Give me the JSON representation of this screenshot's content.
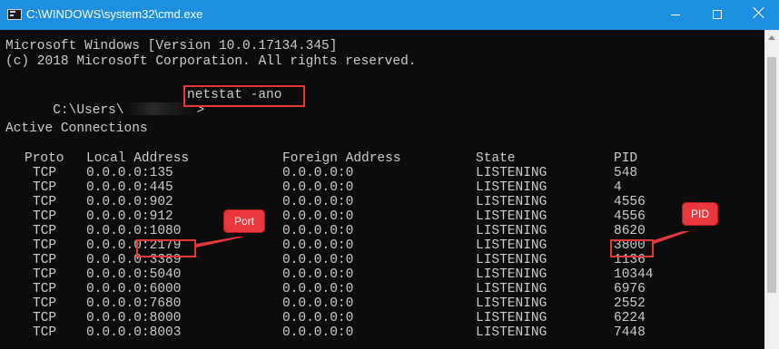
{
  "window": {
    "title": "C:\\WINDOWS\\system32\\cmd.exe",
    "buttons": {
      "minimize": "minimize",
      "maximize": "maximize",
      "close": "close"
    }
  },
  "console": {
    "header_line1": "Microsoft Windows [Version 10.0.17134.345]",
    "header_line2": "(c) 2018 Microsoft Corporation. All rights reserved.",
    "prompt_prefix": "C:\\Users\\",
    "command": "netstat -ano",
    "section_title": "Active Connections",
    "columns": {
      "proto": "Proto",
      "local": "Local Address",
      "foreign": "Foreign Address",
      "state": "State",
      "pid": "PID"
    },
    "rows": [
      {
        "proto": "TCP",
        "local": "0.0.0.0:135",
        "foreign": "0.0.0.0:0",
        "state": "LISTENING",
        "pid": "548"
      },
      {
        "proto": "TCP",
        "local": "0.0.0.0:445",
        "foreign": "0.0.0.0:0",
        "state": "LISTENING",
        "pid": "4"
      },
      {
        "proto": "TCP",
        "local": "0.0.0.0:902",
        "foreign": "0.0.0.0:0",
        "state": "LISTENING",
        "pid": "4556"
      },
      {
        "proto": "TCP",
        "local": "0.0.0.0:912",
        "foreign": "0.0.0.0:0",
        "state": "LISTENING",
        "pid": "4556"
      },
      {
        "proto": "TCP",
        "local": "0.0.0.0:1080",
        "foreign": "0.0.0.0:0",
        "state": "LISTENING",
        "pid": "8620"
      },
      {
        "proto": "TCP",
        "local": "0.0.0.0:2179",
        "foreign": "0.0.0.0:0",
        "state": "LISTENING",
        "pid": "3800"
      },
      {
        "proto": "TCP",
        "local": "0.0.0.0:3389",
        "foreign": "0.0.0.0:0",
        "state": "LISTENING",
        "pid": "1136"
      },
      {
        "proto": "TCP",
        "local": "0.0.0.0:5040",
        "foreign": "0.0.0.0:0",
        "state": "LISTENING",
        "pid": "10344"
      },
      {
        "proto": "TCP",
        "local": "0.0.0.0:6000",
        "foreign": "0.0.0.0:0",
        "state": "LISTENING",
        "pid": "6976"
      },
      {
        "proto": "TCP",
        "local": "0.0.0.0:7680",
        "foreign": "0.0.0.0:0",
        "state": "LISTENING",
        "pid": "2552"
      },
      {
        "proto": "TCP",
        "local": "0.0.0.0:8000",
        "foreign": "0.0.0.0:0",
        "state": "LISTENING",
        "pid": "6224"
      },
      {
        "proto": "TCP",
        "local": "0.0.0.0:8003",
        "foreign": "0.0.0.0:0",
        "state": "LISTENING",
        "pid": "7448"
      }
    ]
  },
  "annotations": {
    "port_label": "Port",
    "pid_label": "PID",
    "highlight_color": "#e53935"
  },
  "colors": {
    "titlebar": "#1e8fe0",
    "console_bg": "#0c0c0c",
    "console_text": "#cccccc"
  }
}
